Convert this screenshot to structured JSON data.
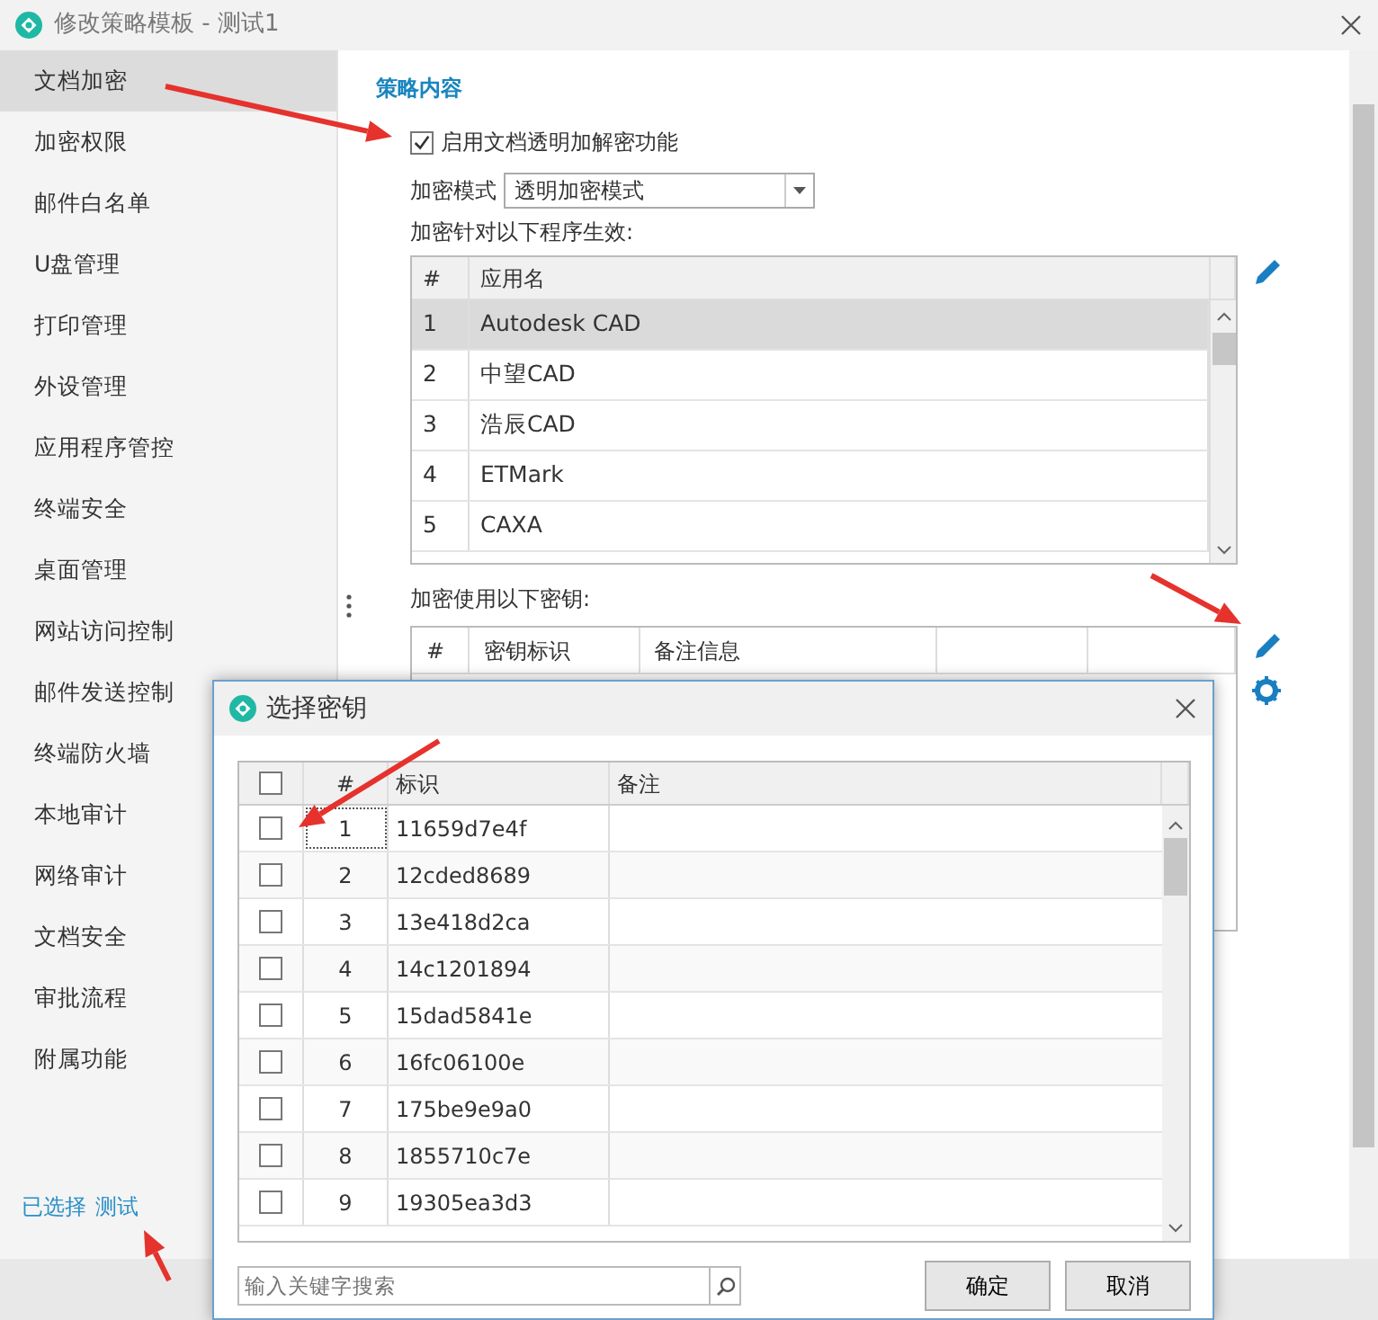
{
  "window": {
    "title": "修改策略模板 - 测试1"
  },
  "sidebar": {
    "items": [
      {
        "label": "文档加密",
        "selected": true
      },
      {
        "label": "加密权限",
        "selected": false
      },
      {
        "label": "邮件白名单",
        "selected": false
      },
      {
        "label": "U盘管理",
        "selected": false
      },
      {
        "label": "打印管理",
        "selected": false
      },
      {
        "label": "外设管理",
        "selected": false
      },
      {
        "label": "应用程序管控",
        "selected": false
      },
      {
        "label": "终端安全",
        "selected": false
      },
      {
        "label": "桌面管理",
        "selected": false
      },
      {
        "label": "网站访问控制",
        "selected": false
      },
      {
        "label": "邮件发送控制",
        "selected": false
      },
      {
        "label": "终端防火墙",
        "selected": false
      },
      {
        "label": "本地审计",
        "selected": false
      },
      {
        "label": "网络审计",
        "selected": false
      },
      {
        "label": "文档安全",
        "selected": false
      },
      {
        "label": "审批流程",
        "selected": false
      },
      {
        "label": "附属功能",
        "selected": false
      }
    ],
    "footer_label": "已选择",
    "footer_value": "测试"
  },
  "content": {
    "section_title": "策略内容",
    "enable_checkbox": {
      "label": "启用文档透明加解密功能",
      "checked": true
    },
    "mode": {
      "label": "加密模式",
      "value": "透明加密模式"
    },
    "apps_label": "加密针对以下程序生效:",
    "apps_table": {
      "columns": [
        "#",
        "应用名"
      ],
      "rows": [
        {
          "cells": [
            "1",
            "Autodesk CAD"
          ],
          "selected": true
        },
        {
          "cells": [
            "2",
            "中望CAD"
          ],
          "selected": false
        },
        {
          "cells": [
            "3",
            "浩辰CAD"
          ],
          "selected": false
        },
        {
          "cells": [
            "4",
            "ETMark"
          ],
          "selected": false
        },
        {
          "cells": [
            "5",
            "CAXA"
          ],
          "selected": false
        }
      ]
    },
    "keys_label": "加密使用以下密钥:",
    "keys_table": {
      "columns": [
        "#",
        "密钥标识",
        "备注信息"
      ]
    }
  },
  "dialog": {
    "title": "选择密钥",
    "select_all": {
      "checked": false
    },
    "columns": [
      "#",
      "标识",
      "备注"
    ],
    "rows": [
      {
        "number": "1",
        "key": "11659d7e4f",
        "checked": false,
        "focused": true
      },
      {
        "number": "2",
        "key": "12cded8689",
        "checked": false,
        "focused": false
      },
      {
        "number": "3",
        "key": "13e418d2ca",
        "checked": false,
        "focused": false
      },
      {
        "number": "4",
        "key": "14c1201894",
        "checked": false,
        "focused": false
      },
      {
        "number": "5",
        "key": "15dad5841e",
        "checked": false,
        "focused": false
      },
      {
        "number": "6",
        "key": "16fc06100e",
        "checked": false,
        "focused": false
      },
      {
        "number": "7",
        "key": "175be9e9a0",
        "checked": false,
        "focused": false
      },
      {
        "number": "8",
        "key": "1855710c7e",
        "checked": false,
        "focused": false
      },
      {
        "number": "9",
        "key": "19305ea3d3",
        "checked": false,
        "focused": false
      }
    ],
    "search": {
      "placeholder": "输入关键字搜索"
    },
    "buttons": [
      "确定",
      "取消"
    ]
  }
}
